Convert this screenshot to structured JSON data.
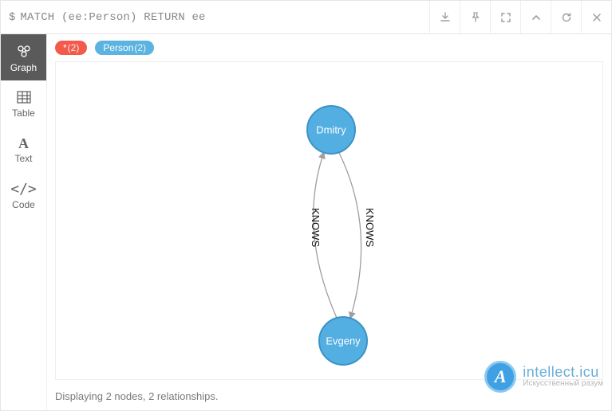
{
  "query": {
    "prompt": "$",
    "text": "MATCH (ee:Person) RETURN ee"
  },
  "toolbar": {
    "download": "download-icon",
    "pin": "pin-icon",
    "fullscreen": "fullscreen-icon",
    "collapse": "collapse-icon",
    "rerun": "rerun-icon",
    "close": "close-icon"
  },
  "sidebar": {
    "items": [
      {
        "id": "graph",
        "label": "Graph",
        "icon": "graph-icon",
        "active": true
      },
      {
        "id": "table",
        "label": "Table",
        "icon": "table-icon",
        "active": false
      },
      {
        "id": "text",
        "label": "Text",
        "icon": "text-icon",
        "active": false
      },
      {
        "id": "code",
        "label": "Code",
        "icon": "code-icon",
        "active": false
      }
    ]
  },
  "chips": [
    {
      "label": "*",
      "count": "(2)",
      "color": "red"
    },
    {
      "label": "Person",
      "count": "(2)",
      "color": "blue"
    }
  ],
  "graph": {
    "nodes": [
      {
        "id": "n1",
        "label": "Dmitry"
      },
      {
        "id": "n2",
        "label": "Evgeny"
      }
    ],
    "relationships": [
      {
        "from": "n2",
        "to": "n1",
        "type": "KNOWS"
      },
      {
        "from": "n1",
        "to": "n2",
        "type": "KNOWS"
      }
    ]
  },
  "status": "Displaying 2 nodes, 2 relationships.",
  "watermark": {
    "title": "intellect.icu",
    "sub": "Искусственный разум",
    "glyph": "A"
  }
}
